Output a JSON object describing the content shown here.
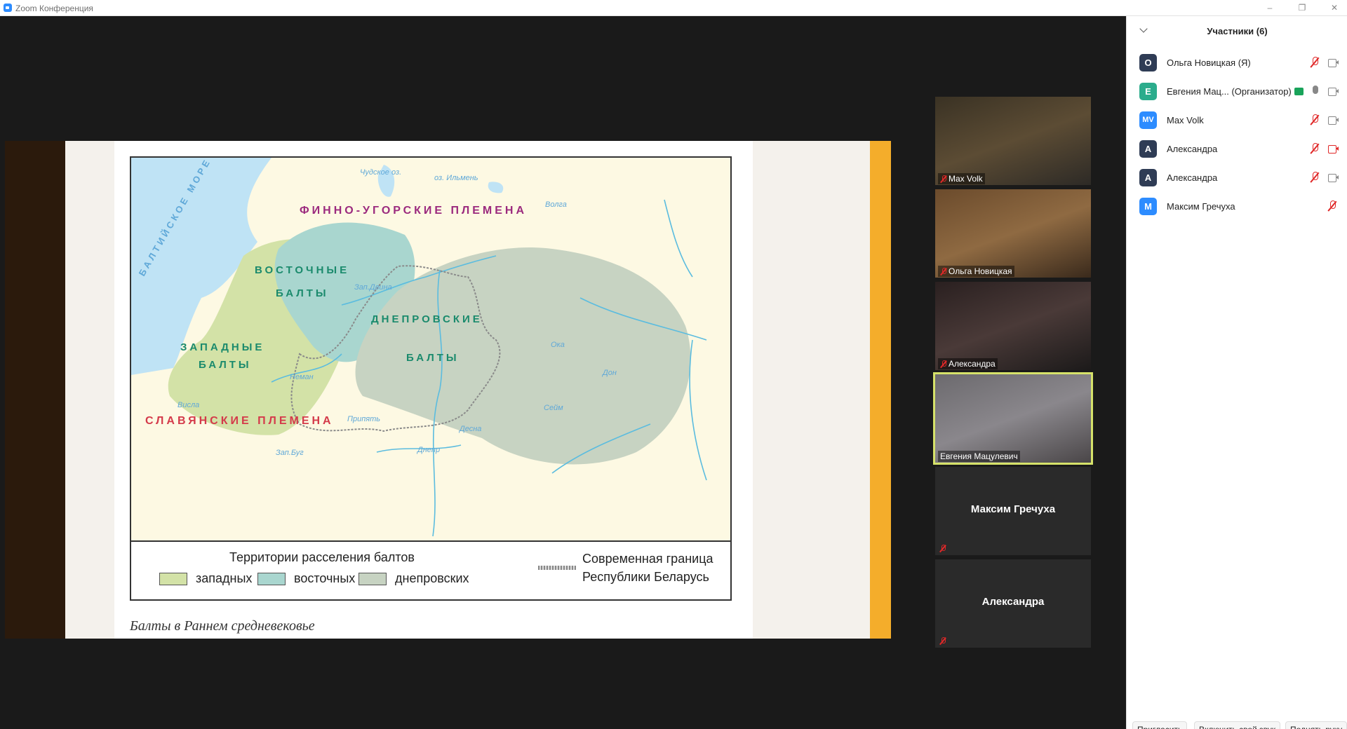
{
  "window": {
    "title": "Zoom Конференция"
  },
  "shared_content": {
    "map_labels": {
      "sea": "БАЛТИЙСКОЕ МОРЕ",
      "lake1": "Чудское оз.",
      "lake2": "оз. Ильмень",
      "finno": "ФИННО-УГОРСКИЕ ПЛЕМЕНА",
      "east1": "ВОСТОЧНЫЕ",
      "east2": "БАЛТЫ",
      "west1": "ЗАПАДНЫЕ",
      "west2": "БАЛТЫ",
      "dnepr1": "ДНЕПРОВСКИЕ",
      "dnepr2": "БАЛТЫ",
      "slav": "СЛАВЯНСКИЕ ПЛЕМЕНА",
      "river_volga": "Волга",
      "river_oka": "Ока",
      "river_don": "Дон",
      "river_seim": "Сейм",
      "river_desna": "Десна",
      "river_pripyat": "Припять",
      "river_dnepr": "Днепр",
      "river_neman": "Неман",
      "river_visla": "Висла",
      "river_zdvina": "Зап.Двина",
      "river_zbug": "Зап.Буг"
    },
    "legend": {
      "title": "Территории расселения балтов",
      "west": "западных",
      "east": "восточных",
      "dnepr": "днепровских",
      "border_line1": "Современная граница",
      "border_line2": "Республики Беларусь"
    },
    "caption": "Балты в Раннем средневековье",
    "colors": {
      "west": "#d3e2a7",
      "east": "#a9d6cf",
      "dnepr": "#c7d3c2",
      "water": "#bfe3f5",
      "land": "#fdf9e3"
    }
  },
  "video_tiles": [
    {
      "name": "Max Volk",
      "muted": true
    },
    {
      "name": "Ольга Новицкая",
      "muted": true
    },
    {
      "name": "Александра",
      "muted": true
    },
    {
      "name": "Евгения Мацулевич",
      "muted": false,
      "active_speaker": true
    },
    {
      "name": "Максим Гречуха",
      "muted": true,
      "video": false
    },
    {
      "name": "Александра",
      "muted": true,
      "video": false
    }
  ],
  "participants": {
    "title": "Участники (6)",
    "list": [
      {
        "initials": "О",
        "name": "Ольга Новицкая (Я)",
        "color": "#2f3c55",
        "mic": "muted",
        "cam": "on"
      },
      {
        "initials": "Е",
        "name": "Евгения Мац...  (Организатор)",
        "color": "#2bac8c",
        "mic": "live",
        "cam": "on",
        "host": true
      },
      {
        "initials": "MV",
        "name": "Max Volk",
        "color": "#2d8cff",
        "mic": "muted",
        "cam": "on"
      },
      {
        "initials": "А",
        "name": "Александра",
        "color": "#2f3c55",
        "mic": "muted",
        "cam": "off"
      },
      {
        "initials": "А",
        "name": "Александра",
        "color": "#2f3c55",
        "mic": "muted",
        "cam": "on"
      },
      {
        "initials": "М",
        "name": "Максим Гречуха",
        "color": "#2d8cff",
        "mic": "muted",
        "cam": "none"
      }
    ]
  },
  "buttons": {
    "invite": "Пригласить",
    "unmute": "Включить свой звук",
    "raise_hand": "Поднять руку"
  }
}
